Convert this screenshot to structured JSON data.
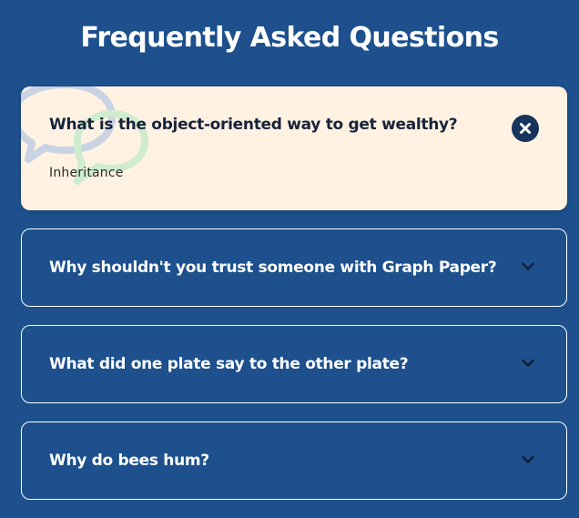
{
  "page": {
    "title": "Frequently Asked Questions"
  },
  "colors": {
    "background": "#1d508c",
    "open_card": "#fff2e3",
    "close_button": "#17345d",
    "bubble_blue": "#c9d3e3",
    "bubble_green": "#cfeccf"
  },
  "faqs": [
    {
      "question": "What is the object-oriented way to get wealthy?",
      "answer": "Inheritance",
      "expanded": true,
      "icon": "close-icon"
    },
    {
      "question": "Why shouldn't you trust someone with Graph Paper?",
      "expanded": false,
      "icon": "chevron-down-icon"
    },
    {
      "question": "What did one plate say to the other plate?",
      "expanded": false,
      "icon": "chevron-down-icon"
    },
    {
      "question": "Why do bees hum?",
      "expanded": false,
      "icon": "chevron-down-icon"
    }
  ]
}
